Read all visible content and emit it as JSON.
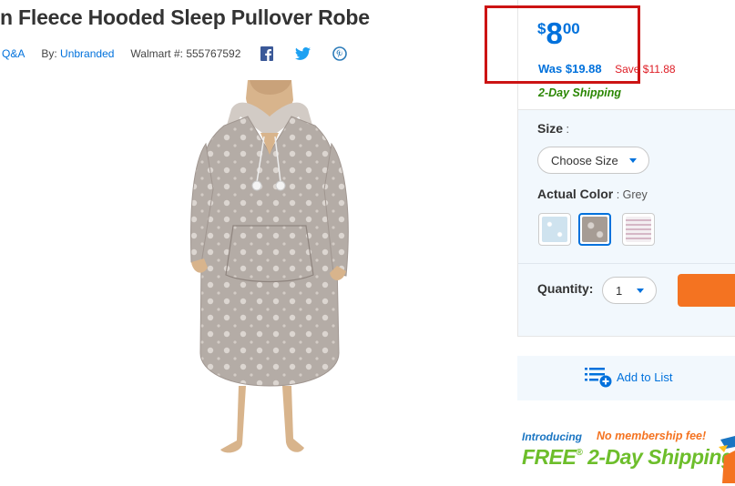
{
  "product": {
    "title": "n Fleece Hooded Sleep Pullover Robe",
    "qa_link": "Q&A",
    "by_label": "By:",
    "brand": "Unbranded",
    "walmart_no": "Walmart #: 555767592"
  },
  "share_icons": [
    "facebook-icon",
    "twitter-icon",
    "pinterest-icon"
  ],
  "price": {
    "currency": "$",
    "dollars": "8",
    "cents": "00",
    "was": "Was $19.88",
    "save": "Save $11.88",
    "shipping": "2-Day Shipping"
  },
  "options": {
    "size_label": "Size",
    "size_colon": " :",
    "size_select": "Choose Size",
    "color_label": "Actual Color",
    "color_colon": " : ",
    "color_value": "Grey",
    "swatches": [
      {
        "name": "Light Blue",
        "color": "#cfe3ef",
        "selected": false
      },
      {
        "name": "Grey",
        "color": "#a69c94",
        "selected": true
      },
      {
        "name": "Pink Stripe",
        "color": "#e9dbe2",
        "selected": false
      }
    ],
    "quantity_label": "Quantity:",
    "quantity_value": "1"
  },
  "add_to_list": "Add to List",
  "promo": {
    "introducing": "Introducing",
    "no_fee": "No membership fee!",
    "free_prefix": "FREE",
    "registered": "®",
    "free_suffix": " 2-Day Shipping"
  },
  "colors": {
    "accent_blue": "#0071dc",
    "save_red": "#de1c24",
    "shipping_green": "#2a8703",
    "cart_orange": "#f47321",
    "highlight_red": "#cc1313"
  }
}
